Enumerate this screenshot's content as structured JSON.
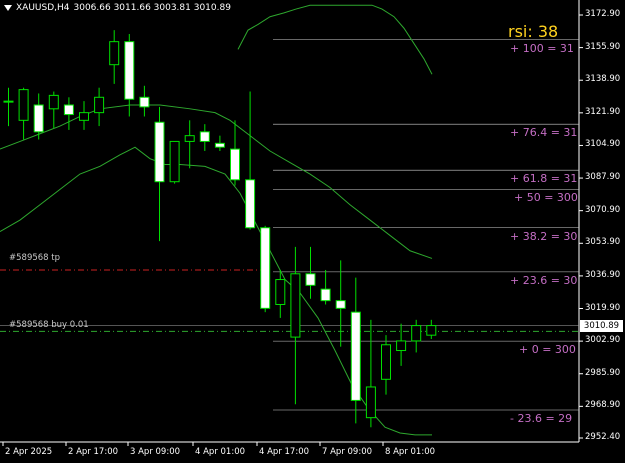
{
  "header": {
    "symbol_timeframe": "XAUUSD,H4",
    "ohlc": "3006.66 3011.66 3003.81 3010.89"
  },
  "indicators": {
    "rsi_label": "rsi: 38"
  },
  "orders": {
    "tp_label": "#589568 tp",
    "buy_label": "#589568 buy 0.01"
  },
  "current_price": "3010.89",
  "price_axis": [
    "3172.90",
    "3155.90",
    "3138.90",
    "3121.90",
    "3104.90",
    "3087.90",
    "3070.90",
    "3053.90",
    "3036.90",
    "3019.90",
    "3002.90",
    "2985.90",
    "2968.90",
    "2952.40"
  ],
  "time_axis": [
    "2 Apr 2025",
    "2 Apr 17:00",
    "3 Apr 09:00",
    "4 Apr 01:00",
    "4 Apr 17:00",
    "7 Apr 09:00",
    "8 Apr 01:00"
  ],
  "fib_levels": [
    {
      "label": "+ 100  = 31",
      "price": 3160.0
    },
    {
      "label": "+ 76.4  = 31",
      "price": 3116.0
    },
    {
      "label": "+ 61.8  = 31",
      "price": 3092.0
    },
    {
      "label": "+ 50  = 300",
      "price": 3082.0
    },
    {
      "label": "+ 38.2  = 30",
      "price": 3062.0
    },
    {
      "label": "+ 23.6  = 30",
      "price": 3039.0
    },
    {
      "label": "+ 0  = 300",
      "price": 3002.9
    },
    {
      "label": "- 23.6  = 29",
      "price": 2967.0
    }
  ],
  "colors": {
    "background": "#000000",
    "candle_bull": "#000000",
    "candle_bear": "#ffffff",
    "wick": "#00e000",
    "bollinger": "#2ea82e",
    "fib": "#c46ec4",
    "rsi": "#ffd21f",
    "tp_line": "#cc2222",
    "buy_line": "#2ea82e"
  },
  "chart_data": {
    "type": "candlestick",
    "symbol": "XAUUSD",
    "timeframe": "H4",
    "ylim": [
      2950,
      3178
    ],
    "candles": [
      {
        "o": 3128,
        "h": 3135,
        "l": 3115,
        "c": 3128
      },
      {
        "o": 3118,
        "h": 3135,
        "l": 3108,
        "c": 3134
      },
      {
        "o": 3126,
        "h": 3132,
        "l": 3108,
        "c": 3112
      },
      {
        "o": 3124,
        "h": 3133,
        "l": 3114,
        "c": 3131
      },
      {
        "o": 3126,
        "h": 3130,
        "l": 3113,
        "c": 3121
      },
      {
        "o": 3118,
        "h": 3128,
        "l": 3113,
        "c": 3122
      },
      {
        "o": 3122,
        "h": 3135,
        "l": 3115,
        "c": 3130
      },
      {
        "o": 3147,
        "h": 3165,
        "l": 3137,
        "c": 3159
      },
      {
        "o": 3159,
        "h": 3163,
        "l": 3120,
        "c": 3129
      },
      {
        "o": 3130,
        "h": 3136,
        "l": 3120,
        "c": 3125
      },
      {
        "o": 3117,
        "h": 3125,
        "l": 3055,
        "c": 3086
      },
      {
        "o": 3086,
        "h": 3105,
        "l": 3085,
        "c": 3107
      },
      {
        "o": 3107,
        "h": 3118,
        "l": 3093,
        "c": 3110
      },
      {
        "o": 3112,
        "h": 3116,
        "l": 3102,
        "c": 3107
      },
      {
        "o": 3106,
        "h": 3110,
        "l": 3102,
        "c": 3104
      },
      {
        "o": 3103,
        "h": 3118,
        "l": 3084,
        "c": 3087
      },
      {
        "o": 3087,
        "h": 3133,
        "l": 3061,
        "c": 3062
      },
      {
        "o": 3062,
        "h": 3063,
        "l": 3018,
        "c": 3020
      },
      {
        "o": 3022,
        "h": 3040,
        "l": 3015,
        "c": 3035
      },
      {
        "o": 3005,
        "h": 3052,
        "l": 2970,
        "c": 3038
      },
      {
        "o": 3038,
        "h": 3052,
        "l": 3025,
        "c": 3032
      },
      {
        "o": 3030,
        "h": 3040,
        "l": 3022,
        "c": 3024
      },
      {
        "o": 3024,
        "h": 3045,
        "l": 3000,
        "c": 3020
      },
      {
        "o": 3018,
        "h": 3036,
        "l": 2960,
        "c": 2972
      },
      {
        "o": 2963,
        "h": 3014,
        "l": 2958,
        "c": 2979
      },
      {
        "o": 2983,
        "h": 3006,
        "l": 2975,
        "c": 3001
      },
      {
        "o": 2998,
        "h": 3012,
        "l": 2990,
        "c": 3003
      },
      {
        "o": 3003,
        "h": 3014,
        "l": 2997,
        "c": 3011
      },
      {
        "o": 3006,
        "h": 3014,
        "l": 3004,
        "c": 3011
      }
    ],
    "bollinger_upper": [
      [
        238,
        3155
      ],
      [
        248,
        3165
      ],
      [
        258,
        3168
      ],
      [
        270,
        3172
      ],
      [
        284,
        3174
      ],
      [
        296,
        3176
      ],
      [
        310,
        3178
      ],
      [
        326,
        3178
      ],
      [
        342,
        3178
      ],
      [
        360,
        3178
      ],
      [
        372,
        3178
      ],
      [
        382,
        3176
      ],
      [
        394,
        3172
      ],
      [
        404,
        3166
      ],
      [
        414,
        3158
      ],
      [
        424,
        3150
      ],
      [
        432,
        3142
      ]
    ],
    "bollinger_middle": [
      [
        0,
        3103
      ],
      [
        20,
        3107
      ],
      [
        40,
        3111
      ],
      [
        60,
        3115
      ],
      [
        80,
        3120
      ],
      [
        100,
        3124
      ],
      [
        130,
        3126
      ],
      [
        160,
        3126
      ],
      [
        190,
        3124
      ],
      [
        215,
        3122
      ],
      [
        230,
        3118
      ],
      [
        250,
        3110
      ],
      [
        270,
        3102
      ],
      [
        290,
        3096
      ],
      [
        310,
        3090
      ],
      [
        330,
        3083
      ],
      [
        350,
        3074
      ],
      [
        370,
        3066
      ],
      [
        390,
        3058
      ],
      [
        410,
        3050
      ],
      [
        432,
        3046
      ]
    ],
    "bollinger_lower": [
      [
        0,
        3060
      ],
      [
        20,
        3066
      ],
      [
        40,
        3074
      ],
      [
        60,
        3082
      ],
      [
        80,
        3090
      ],
      [
        100,
        3094
      ],
      [
        120,
        3100
      ],
      [
        135,
        3104
      ],
      [
        150,
        3098
      ],
      [
        165,
        3095
      ],
      [
        180,
        3095
      ],
      [
        205,
        3094
      ],
      [
        225,
        3090
      ],
      [
        240,
        3080
      ],
      [
        255,
        3065
      ],
      [
        270,
        3050
      ],
      [
        285,
        3035
      ],
      [
        300,
        3028
      ],
      [
        318,
        3015
      ],
      [
        335,
        2998
      ],
      [
        352,
        2980
      ],
      [
        368,
        2968
      ],
      [
        385,
        2958
      ],
      [
        400,
        2955
      ],
      [
        415,
        2954
      ],
      [
        432,
        2954
      ]
    ],
    "tp_price": 3040,
    "buy_price": 3008
  }
}
